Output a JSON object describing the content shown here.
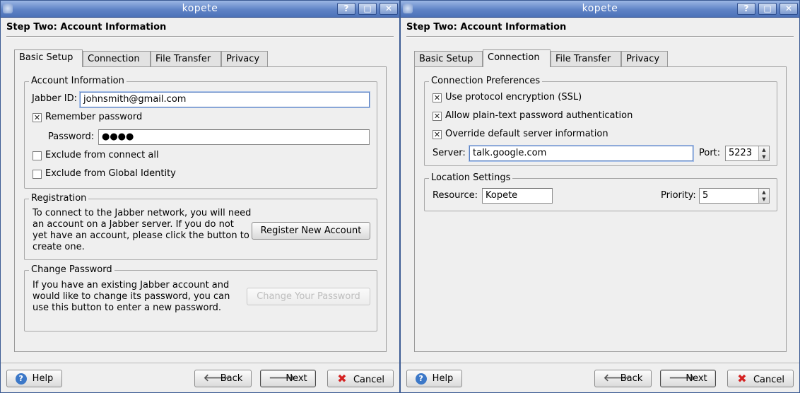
{
  "left_window": {
    "title": "kopete",
    "heading": "Step Two: Account Information",
    "tabs": [
      "Basic Setup",
      "Connection",
      "File Transfer",
      "Privacy"
    ],
    "account_info": {
      "group_title": "Account Information",
      "jabber_id_label": "Jabber ID:",
      "jabber_id_value": "johnsmith@gmail.com",
      "remember_password_label": "Remember password",
      "password_label": "Password:",
      "password_value": "●●●●",
      "exclude_connect_label": "Exclude from connect all",
      "exclude_identity_label": "Exclude from Global Identity"
    },
    "registration": {
      "group_title": "Registration",
      "text_lines": [
        "To connect to the Jabber network, you will need",
        "an account on a Jabber server.  If you do not",
        "yet have an account, please click the button to",
        "create one."
      ],
      "button_label": "Register New Account"
    },
    "change_password": {
      "group_title": "Change Password",
      "text_lines": [
        "If you have an existing Jabber account and",
        "would like to change its password, you can",
        "use this button to enter a new password."
      ],
      "button_label": "Change Your Password"
    },
    "buttons": {
      "help": "Help",
      "back": "Back",
      "next": "Next",
      "cancel": "Cancel"
    }
  },
  "right_window": {
    "title": "kopete",
    "heading": "Step Two: Account Information",
    "tabs": [
      "Basic Setup",
      "Connection",
      "File Transfer",
      "Privacy"
    ],
    "connection_prefs": {
      "group_title": "Connection Preferences",
      "ssl_label": "Use protocol encryption (SSL)",
      "plaintext_label": "Allow plain-text password authentication",
      "override_label": "Override default server information",
      "server_label": "Server:",
      "server_value": "talk.google.com",
      "port_label": "Port:",
      "port_value": "5223"
    },
    "location": {
      "group_title": "Location Settings",
      "resource_label": "Resource:",
      "resource_value": "Kopete",
      "priority_label": "Priority:",
      "priority_value": "5"
    },
    "buttons": {
      "help": "Help",
      "back": "Back",
      "next": "Next",
      "cancel": "Cancel"
    }
  },
  "check_glyph": "✕"
}
